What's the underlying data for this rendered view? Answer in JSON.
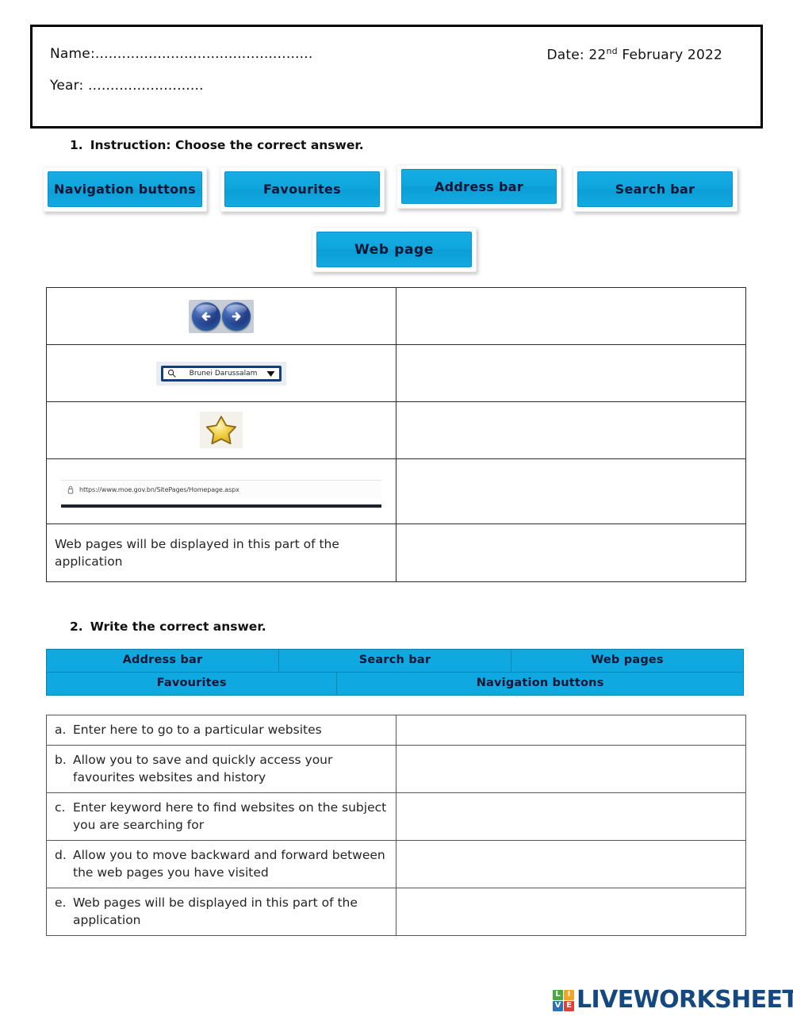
{
  "header": {
    "name_label": "Name:.................................................",
    "year_label": "Year: ..........................",
    "date_label": "Date: 22",
    "date_sup": "nd",
    "date_rest": " February 2022"
  },
  "section1": {
    "number": "1.",
    "instruction": "Instruction: Choose the correct answer.",
    "options": [
      {
        "label": "Navigation buttons"
      },
      {
        "label": "Favourites"
      },
      {
        "label": "Address bar"
      },
      {
        "label": "Search bar"
      },
      {
        "label": "Web page"
      }
    ],
    "rows": [
      {
        "kind": "nav-arrows",
        "alt": "back-and-forward-arrow-buttons",
        "answer": ""
      },
      {
        "kind": "search-box",
        "query": "Brunei Darussalam",
        "answer": ""
      },
      {
        "kind": "star",
        "alt": "gold-star-favourites-icon",
        "answer": ""
      },
      {
        "kind": "url-bar",
        "url": "https://www.moe.gov.bn/SitePages/Homepage.aspx",
        "answer": ""
      },
      {
        "kind": "text",
        "text": "Web pages will be displayed in this part of the application",
        "answer": ""
      }
    ]
  },
  "section2": {
    "number": "2.",
    "instruction": "Write the correct answer.",
    "wordbank_row1": [
      "Address bar",
      "Search bar",
      "Web pages"
    ],
    "wordbank_row2": [
      "Favourites",
      "Navigation buttons"
    ],
    "items": [
      {
        "marker": "a.",
        "text": "Enter here to go to a particular websites",
        "answer": ""
      },
      {
        "marker": "b.",
        "text": "Allow you to save and quickly access your favourites websites and history",
        "answer": ""
      },
      {
        "marker": "c.",
        "text": "Enter keyword here to find websites on the subject you are searching for",
        "answer": ""
      },
      {
        "marker": "d.",
        "text": "Allow you to move backward and forward between the web pages you have visited",
        "answer": ""
      },
      {
        "marker": "e.",
        "text": "Web pages will be displayed in this part of the application",
        "answer": ""
      }
    ]
  },
  "footer": {
    "logo_tiles": [
      {
        "letter": "L",
        "color": "#49a942"
      },
      {
        "letter": "I",
        "color": "#f0a52a"
      },
      {
        "letter": "V",
        "color": "#2f6fb5"
      },
      {
        "letter": "E",
        "color": "#d9433c"
      }
    ],
    "logo_word": "LIVEWORKSHEETS"
  },
  "colors": {
    "button_blue": "#10a8e0",
    "logo_navy": "#14487f"
  }
}
